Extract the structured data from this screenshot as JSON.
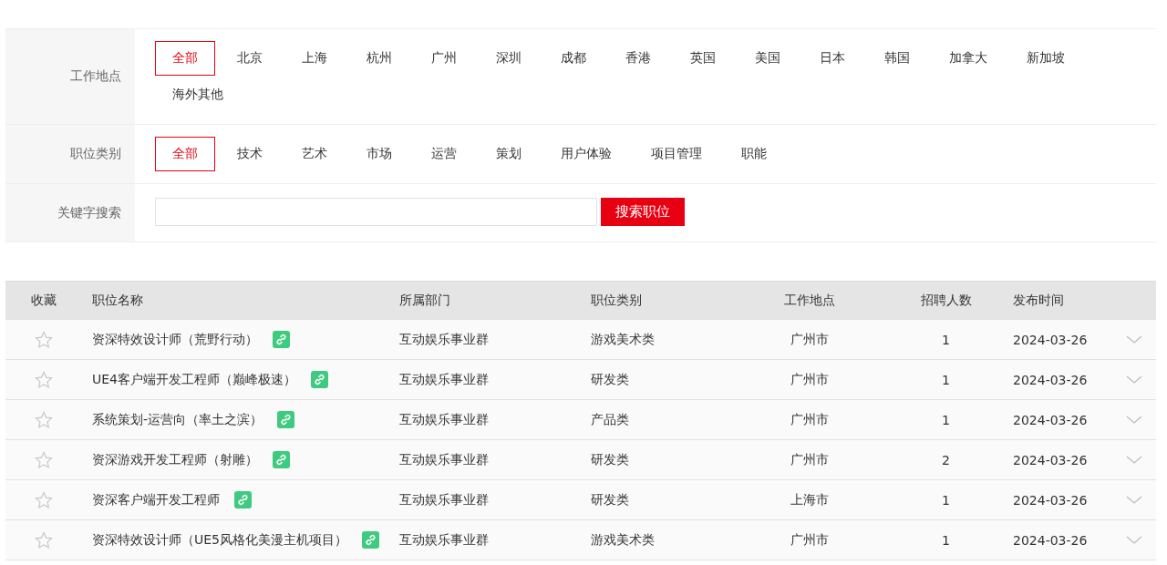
{
  "filters": [
    {
      "kind": "options",
      "label": "工作地点",
      "options": [
        {
          "label": "全部",
          "selected": true
        },
        {
          "label": "北京",
          "selected": false
        },
        {
          "label": "上海",
          "selected": false
        },
        {
          "label": "杭州",
          "selected": false
        },
        {
          "label": "广州",
          "selected": false
        },
        {
          "label": "深圳",
          "selected": false
        },
        {
          "label": "成都",
          "selected": false
        },
        {
          "label": "香港",
          "selected": false
        },
        {
          "label": "英国",
          "selected": false
        },
        {
          "label": "美国",
          "selected": false
        },
        {
          "label": "日本",
          "selected": false
        },
        {
          "label": "韩国",
          "selected": false
        },
        {
          "label": "加拿大",
          "selected": false
        },
        {
          "label": "新加坡",
          "selected": false
        },
        {
          "label": "海外其他",
          "selected": false
        }
      ]
    },
    {
      "kind": "options",
      "label": "职位类别",
      "options": [
        {
          "label": "全部",
          "selected": true
        },
        {
          "label": "技术",
          "selected": false
        },
        {
          "label": "艺术",
          "selected": false
        },
        {
          "label": "市场",
          "selected": false
        },
        {
          "label": "运营",
          "selected": false
        },
        {
          "label": "策划",
          "selected": false
        },
        {
          "label": "用户体验",
          "selected": false
        },
        {
          "label": "项目管理",
          "selected": false
        },
        {
          "label": "职能",
          "selected": false
        }
      ]
    },
    {
      "kind": "search",
      "label": "关键字搜索",
      "button": "搜索职位"
    }
  ],
  "table": {
    "columns": [
      "收藏",
      "职位名称",
      "所属部门",
      "职位类别",
      "工作地点",
      "招聘人数",
      "发布时间"
    ],
    "rows": [
      {
        "favorited": false,
        "expanded": false,
        "title": "资深特效设计师（荒野行动）",
        "department": "互动娱乐事业群",
        "category": "游戏美术类",
        "location": "广州市",
        "openings": "1",
        "date": "2024-03-26"
      },
      {
        "favorited": false,
        "expanded": false,
        "title": "UE4客户端开发工程师（巅峰极速）",
        "department": "互动娱乐事业群",
        "category": "研发类",
        "location": "广州市",
        "openings": "1",
        "date": "2024-03-26"
      },
      {
        "favorited": false,
        "expanded": false,
        "title": "系统策划-运营向（率土之滨）",
        "department": "互动娱乐事业群",
        "category": "产品类",
        "location": "广州市",
        "openings": "1",
        "date": "2024-03-26"
      },
      {
        "favorited": false,
        "expanded": false,
        "title": "资深游戏开发工程师（射雕）",
        "department": "互动娱乐事业群",
        "category": "研发类",
        "location": "广州市",
        "openings": "2",
        "date": "2024-03-26"
      },
      {
        "favorited": false,
        "expanded": false,
        "title": "资深客户端开发工程师",
        "department": "互动娱乐事业群",
        "category": "研发类",
        "location": "上海市",
        "openings": "1",
        "date": "2024-03-26"
      },
      {
        "favorited": false,
        "expanded": false,
        "title": "资深特效设计师（UE5风格化美漫主机项目）",
        "department": "互动娱乐事业群",
        "category": "游戏美术类",
        "location": "广州市",
        "openings": "1",
        "date": "2024-03-26"
      }
    ]
  }
}
